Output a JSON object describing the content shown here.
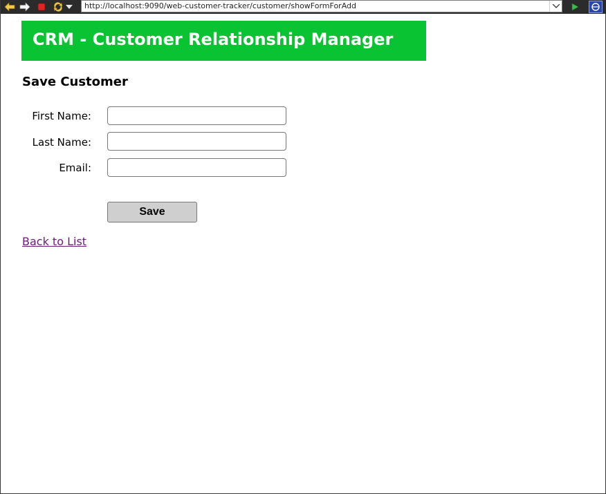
{
  "browser": {
    "url": "http://localhost:9090/web-customer-tracker/customer/showFormForAdd",
    "icons": {
      "back": "back-arrow-icon",
      "forward": "forward-arrow-icon",
      "stop": "stop-icon",
      "refresh": "refresh-icon",
      "history_dropdown": "chevron-down-icon",
      "url_dropdown": "chevron-down-icon",
      "go": "play-icon",
      "extra": "browser-logo-icon"
    }
  },
  "header": {
    "title": "CRM - Customer Relationship Manager",
    "background_color": "#09c332"
  },
  "form": {
    "heading": "Save Customer",
    "fields": [
      {
        "label": "First Name:",
        "value": "",
        "placeholder": ""
      },
      {
        "label": "Last Name:",
        "value": "",
        "placeholder": ""
      },
      {
        "label": "Email:",
        "value": "",
        "placeholder": ""
      }
    ],
    "submit_label": "Save"
  },
  "footer": {
    "back_link": "Back to List",
    "link_color": "#6b1a7a"
  }
}
